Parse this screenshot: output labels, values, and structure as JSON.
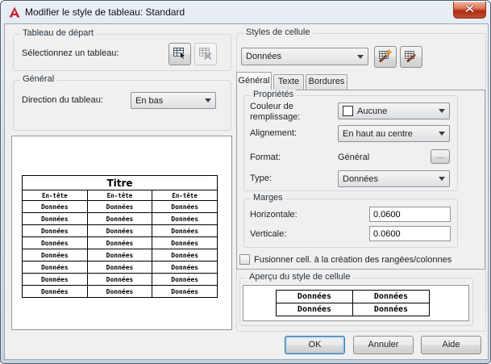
{
  "window": {
    "title": "Modifier le style de tableau: Standard"
  },
  "starting_table": {
    "group_label": "Tableau de départ",
    "select_label": "Sélectionnez un tableau:"
  },
  "general_group": {
    "group_label": "Général",
    "direction_label": "Direction du tableau:",
    "direction_value": "En bas"
  },
  "table_preview": {
    "title": "Titre",
    "headers": [
      "En-tête",
      "En-tête",
      "En-tête"
    ],
    "rows": [
      [
        "Données",
        "Données",
        "Données"
      ],
      [
        "Données",
        "Données",
        "Données"
      ],
      [
        "Données",
        "Données",
        "Données"
      ],
      [
        "Données",
        "Données",
        "Données"
      ],
      [
        "Données",
        "Données",
        "Données"
      ],
      [
        "Données",
        "Données",
        "Données"
      ],
      [
        "Données",
        "Données",
        "Données"
      ],
      [
        "Données",
        "Données",
        "Données"
      ]
    ]
  },
  "cell_styles": {
    "group_label": "Styles de cellule",
    "style_value": "Données",
    "tabs": [
      "Général",
      "Texte",
      "Bordures"
    ],
    "active_tab": "Général",
    "properties": {
      "group_label": "Propriétés",
      "fill_label_line1": "Couleur de",
      "fill_label_line2": "remplissage:",
      "fill_value": "Aucune",
      "alignment_label": "Alignement:",
      "alignment_value": "En haut au centre",
      "format_label": "Format:",
      "format_value": "Général",
      "format_button_label": "...",
      "type_label": "Type:",
      "type_value": "Données"
    },
    "margins": {
      "group_label": "Marges",
      "horizontal_label": "Horizontale:",
      "horizontal_value": "0.0600",
      "vertical_label": "Verticale:",
      "vertical_value": "0.0600"
    },
    "merge_label": "Fusionner cell. à la création des rangées/colonnes",
    "merge_checked": false,
    "cell_preview": {
      "group_label": "Aperçu du style de cellule",
      "rows": [
        [
          "Données",
          "Données"
        ],
        [
          "Données",
          "Données"
        ]
      ]
    }
  },
  "footer": {
    "ok_label": "OK",
    "cancel_label": "Annuler",
    "help_label": "Aide"
  },
  "icons": {
    "app-icon": "autocad-red-a",
    "close-icon": "✕",
    "select-table-icon": "table-with-cursor-arrow",
    "delete-table-icon": "table-with-x (disabled)",
    "new-cell-style-icon": "table-with-star-and-brush",
    "manage-cell-style-icon": "table-with-brush",
    "chevron-down-icon": "▾",
    "fill-color-swatch": "white-square"
  },
  "colors": {
    "dialog_bg": "#f0f0f0",
    "titlebar_glass": "#d5dfeb",
    "close_button_red": "#c84326",
    "star_orange": "#f59a23",
    "brush_brown": "#8c4b26",
    "focus_blue": "#3c7fb1",
    "preview_table_border": "#000000"
  }
}
